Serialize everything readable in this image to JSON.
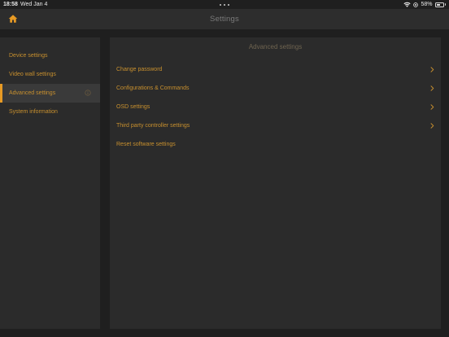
{
  "status_bar": {
    "time": "18:58",
    "date": "Wed Jan 4",
    "battery": "58%",
    "battery_level": 0.58,
    "icons": [
      "wifi-icon",
      "location-icon",
      "battery-icon"
    ]
  },
  "header": {
    "title": "Settings",
    "home_icon": "home-icon"
  },
  "sidebar": {
    "items": [
      {
        "label": "Device settings"
      },
      {
        "label": "Video wall settings"
      },
      {
        "label": "Advanced settings",
        "active": true,
        "icon": "info-icon"
      },
      {
        "label": "System information"
      }
    ]
  },
  "panel": {
    "title": "Advanced settings",
    "items": [
      {
        "label": "Change password",
        "chevron": true
      },
      {
        "label": "Configurations & Commands",
        "chevron": true
      },
      {
        "label": "OSD settings",
        "chevron": true
      },
      {
        "label": "Third party controller settings",
        "chevron": true
      },
      {
        "label": "Reset software settings",
        "chevron": false
      }
    ]
  },
  "colors": {
    "accent": "#e79a24",
    "text_accent": "#c8902e",
    "background": "#1f1f1f",
    "panel": "#2b2b2b",
    "header": "#2d2d2d"
  }
}
